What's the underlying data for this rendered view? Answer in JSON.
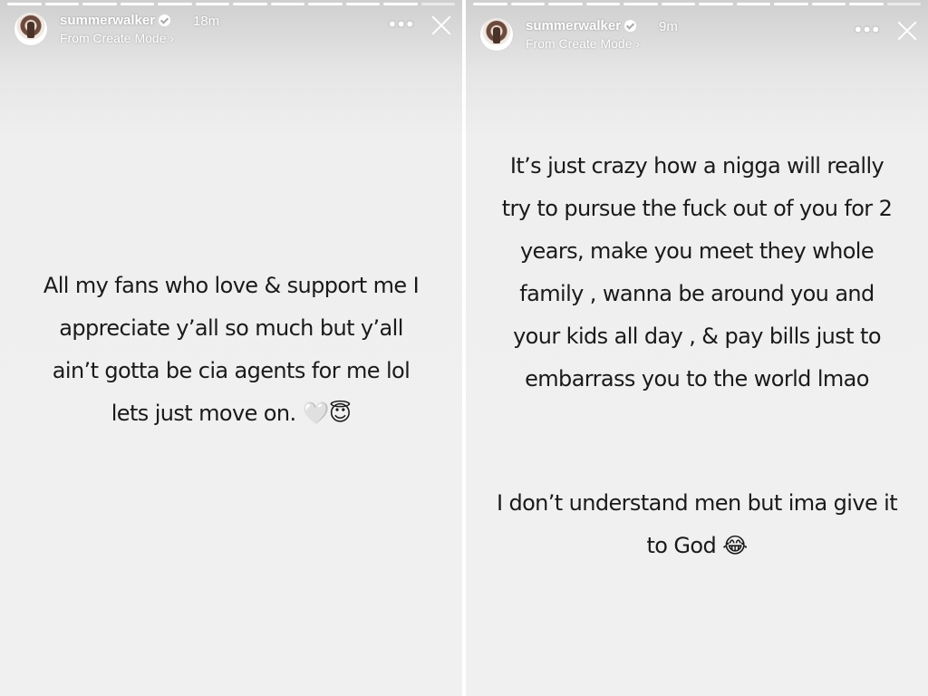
{
  "left_story": {
    "username": "summerwalker",
    "time": "18m",
    "subtitle": "From Create Mode ›",
    "more": "•••",
    "text_lines": [
      "All my fans who love & support me I",
      "appreciate y’all so much but y’all",
      "ain’t gotta be cia agents for me lol",
      "lets just move on."
    ],
    "emojis": [
      "🤍",
      "😇"
    ],
    "progress_total": 12,
    "progress_done": 11,
    "icons": {
      "verified": "verified-badge-icon",
      "close": "close-icon",
      "more": "more-icon"
    }
  },
  "right_story": {
    "username": "summerwalker",
    "time": "9m",
    "subtitle": "From Create Mode ›",
    "more": "•••",
    "paragraph1_lines": [
      "It’s just crazy how a nigga will really",
      "try to pursue the fuck out of you for 2",
      "years, make you meet they whole",
      "family , wanna be around you and",
      "your kids all day , & pay bills just to",
      "embarrass you to the world lmao"
    ],
    "paragraph2_lines": [
      "I don’t understand men but ima give it",
      "to God"
    ],
    "emoji": "😂",
    "progress_total": 12,
    "progress_done": 11
  }
}
